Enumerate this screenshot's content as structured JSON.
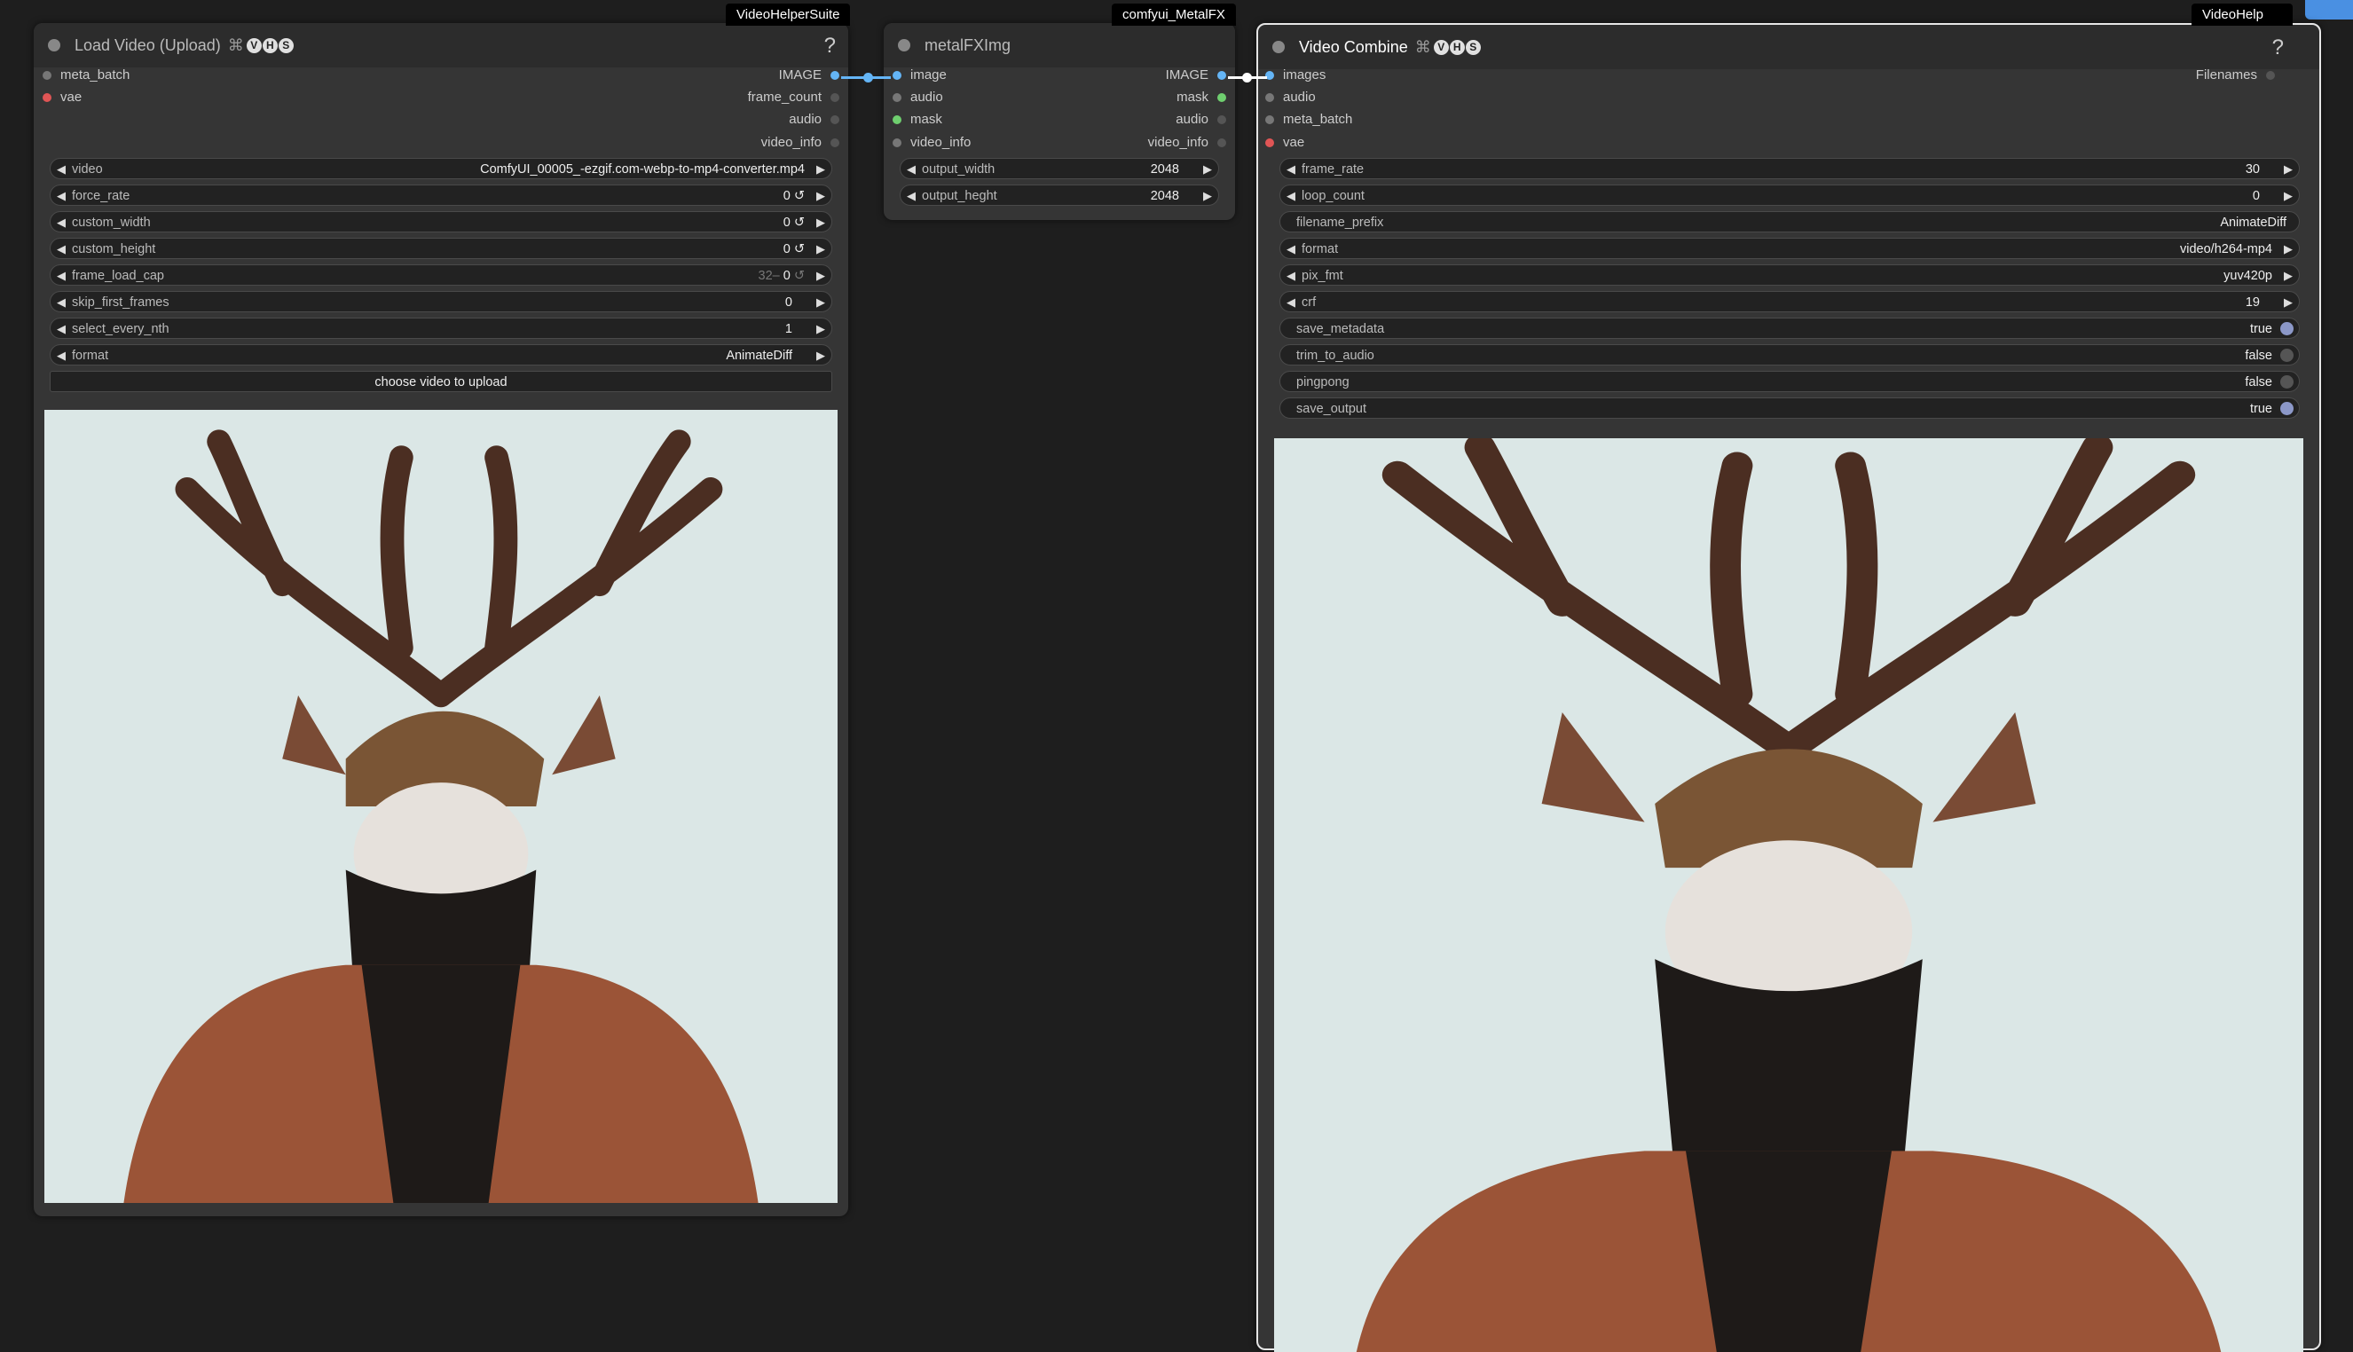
{
  "badges": {
    "left": "VideoHelperSuite",
    "middle": "comfyui_MetalFX",
    "right": "VideoHelp"
  },
  "load_node": {
    "title": "Load Video (Upload)",
    "help": "?",
    "inputs": [
      "meta_batch",
      "vae"
    ],
    "outputs": [
      "IMAGE",
      "frame_count",
      "audio",
      "video_info"
    ],
    "widgets": [
      {
        "label": "video",
        "value": "ComfyUI_00005_-ezgif.com-webp-to-mp4-converter.mp4"
      },
      {
        "label": "force_rate",
        "value": "0"
      },
      {
        "label": "custom_width",
        "value": "0"
      },
      {
        "label": "custom_height",
        "value": "0"
      },
      {
        "label": "frame_load_cap",
        "value": "0",
        "hint": "32–"
      },
      {
        "label": "skip_first_frames",
        "value": "0"
      },
      {
        "label": "select_every_nth",
        "value": "1"
      },
      {
        "label": "format",
        "value": "AnimateDiff"
      }
    ],
    "upload_button": "choose video to upload"
  },
  "metal_node": {
    "title": "metalFXImg",
    "inputs": [
      "image",
      "audio",
      "mask",
      "video_info"
    ],
    "outputs": [
      "IMAGE",
      "mask",
      "audio",
      "video_info"
    ],
    "widgets": [
      {
        "label": "output_width",
        "value": "2048"
      },
      {
        "label": "output_heght",
        "value": "2048"
      }
    ]
  },
  "combine_node": {
    "title": "Video Combine",
    "help": "?",
    "inputs": [
      "images",
      "audio",
      "meta_batch",
      "vae"
    ],
    "outputs": [
      "Filenames"
    ],
    "widgets": [
      {
        "label": "frame_rate",
        "value": "30"
      },
      {
        "label": "loop_count",
        "value": "0"
      },
      {
        "label": "filename_prefix",
        "value": "AnimateDiff"
      },
      {
        "label": "format",
        "value": "video/h264-mp4"
      },
      {
        "label": "pix_fmt",
        "value": "yuv420p"
      },
      {
        "label": "crf",
        "value": "19"
      },
      {
        "label": "save_metadata",
        "value": "true"
      },
      {
        "label": "trim_to_audio",
        "value": "false"
      },
      {
        "label": "pingpong",
        "value": "false"
      },
      {
        "label": "save_output",
        "value": "true"
      }
    ]
  },
  "vhs_letters": [
    "V",
    "H",
    "S"
  ],
  "refresh_glyph": "↺",
  "arrow_left": "◀",
  "arrow_right": "▶",
  "colors": {
    "canvas": "#1e1e1e",
    "node_body": "#353535",
    "wire_image": "#64b5f6",
    "slot_vae": "#e05555",
    "slot_mask": "#6fcf6f"
  }
}
